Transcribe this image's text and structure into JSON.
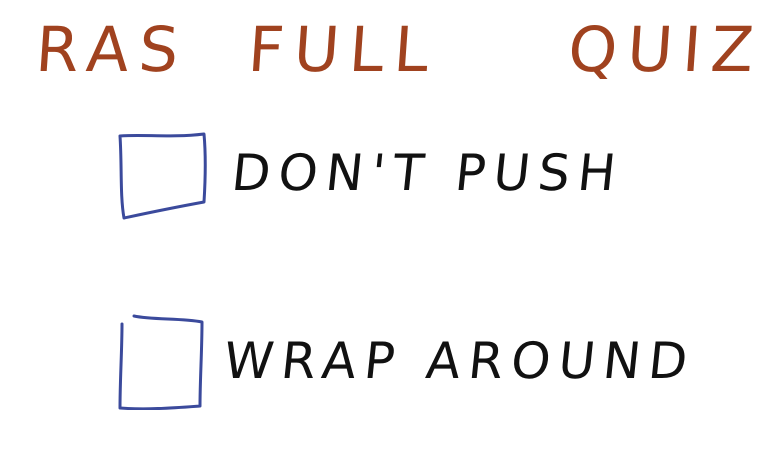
{
  "quiz": {
    "title_words": [
      "RAS",
      "FULL",
      "QUIZ"
    ],
    "accent_color": "#a0421f",
    "checkbox_color": "#3b4a9c",
    "options": [
      {
        "label": "DON'T PUSH",
        "checked": false
      },
      {
        "label": "WRAP AROUND",
        "checked": false
      }
    ]
  }
}
